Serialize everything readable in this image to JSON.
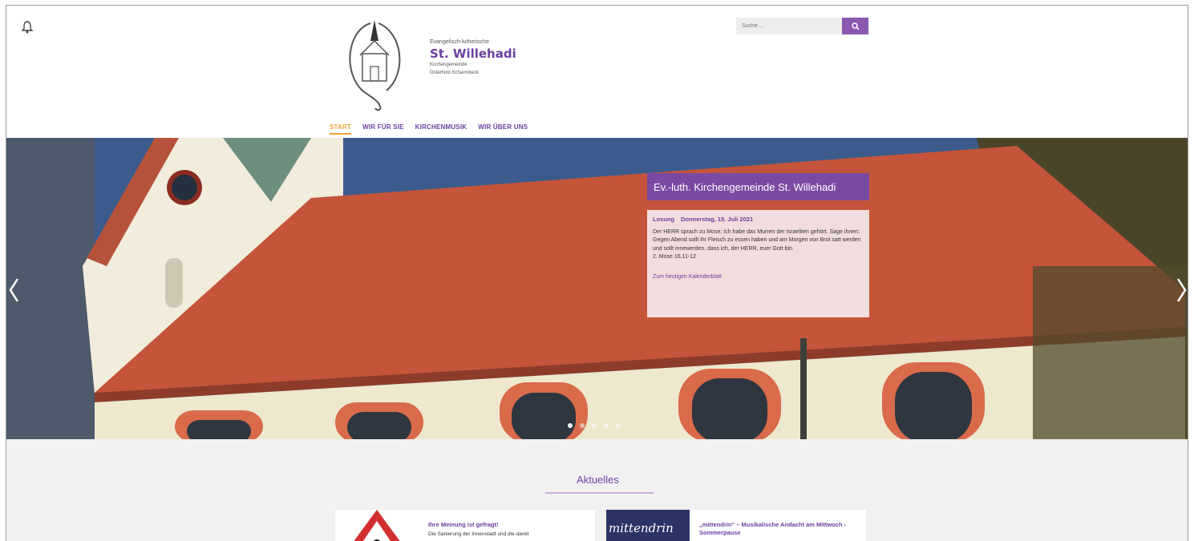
{
  "header": {
    "bell_icon": "bell-icon",
    "logo": {
      "pre": "Evangelisch-lutherische",
      "name": "St. Willehadi",
      "sub1": "Kirchengemeinde",
      "sub2": "Osterholz-Scharmbeck"
    },
    "search": {
      "placeholder": "Suche …",
      "button_icon": "search-icon"
    }
  },
  "nav": {
    "items": [
      {
        "label": "START"
      },
      {
        "label": "WIR FÜR SIE"
      },
      {
        "label": "KIRCHENMUSIK"
      },
      {
        "label": "WIR ÜBER UNS"
      }
    ],
    "active_index": 0
  },
  "hero": {
    "title": "Ev.-luth. Kirchengemeinde St. Willehadi",
    "losung_label": "Losung",
    "losung_date": "Donnerstag, 15. Juli 2021",
    "verse": "Der HERR sprach zu Mose: Ich habe das Murren der Israeliten gehört. Sage ihnen: Gegen Abend sollt ihr Fleisch zu essen haben und am Morgen von Brot satt werden und sollt innewerden, dass ich, der HERR, euer Gott bin.",
    "reference": "2. Mose 16,11-12",
    "link": "Zum heutigen Kalenderblatt",
    "slides": 5,
    "active_slide": 0
  },
  "news": {
    "title": "Aktuelles",
    "cards": [
      {
        "title": "Ihre Meinung ist gefragt!",
        "body": "Die Sanierung der Innenstadt und die damit"
      },
      {
        "image_text": "mittendrin",
        "title": "„mittendrin“ – Musikalische Andacht am Mittwoch - Sommerpause",
        "body": ""
      }
    ]
  },
  "colors": {
    "accent": "#6b3fa0",
    "active_nav": "#f0a23a",
    "roof": "#c4553a"
  }
}
